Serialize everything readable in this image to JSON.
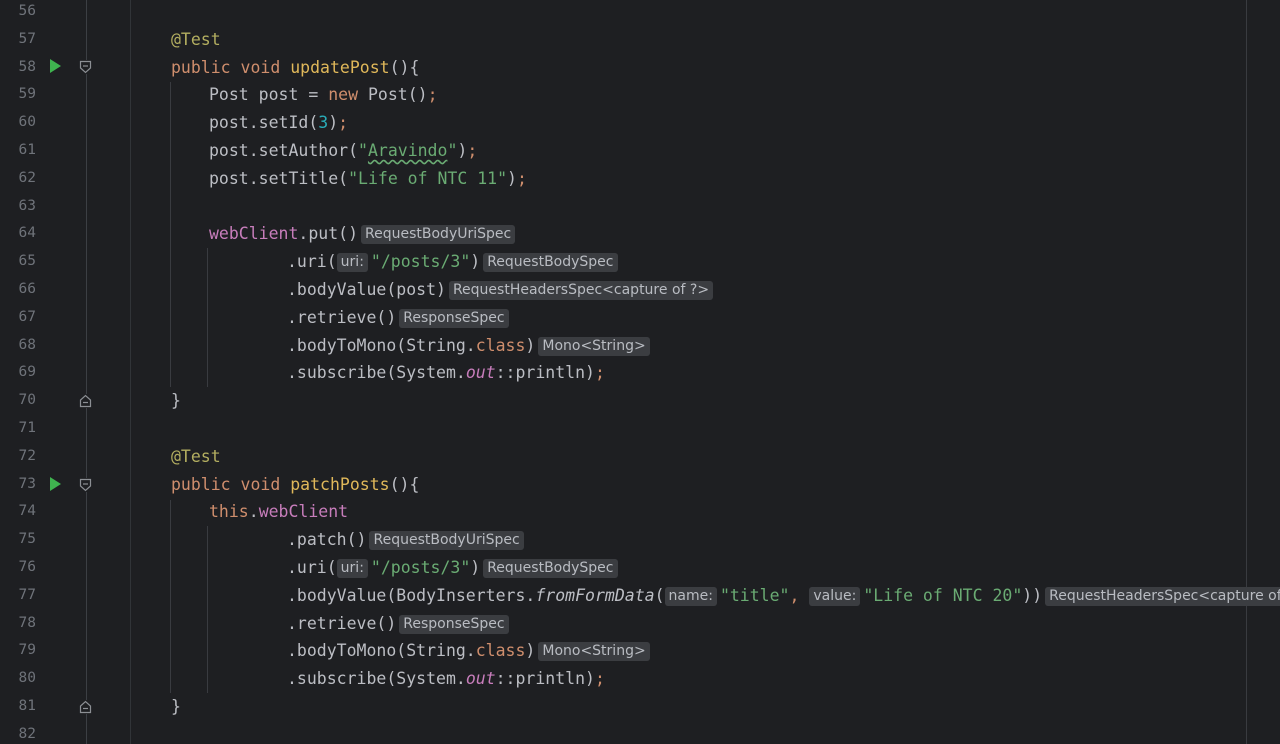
{
  "editor": {
    "background": "#1e1f22",
    "line_numbers": [
      "56",
      "57",
      "58",
      "59",
      "60",
      "61",
      "62",
      "63",
      "64",
      "65",
      "66",
      "67",
      "68",
      "69",
      "70",
      "71",
      "72",
      "73",
      "74",
      "75",
      "76",
      "77",
      "78",
      "79",
      "80",
      "81",
      "82"
    ],
    "colors": {
      "keyword": "#cf8e6d",
      "method_declaration": "#e0b85a",
      "field": "#c77dbb",
      "string": "#6aab73",
      "number": "#2aacb8",
      "annotation": "#b3ae60",
      "text": "#bcbec4",
      "run_icon": "#3fb34f"
    }
  },
  "code": {
    "l57": {
      "annotation": "@Test"
    },
    "l58": {
      "kw1": "public",
      "kw2": "void",
      "name": "updatePost",
      "rest": "(){"
    },
    "l59": {
      "a": "Post post = ",
      "kw": "new",
      "b": " Post()",
      "semi": ";"
    },
    "l60": {
      "a": "post.setId(",
      "num": "3",
      "b": ")",
      "semi": ";"
    },
    "l61": {
      "a": "post.setAuthor(",
      "str_q1": "\"",
      "str_word": "Aravindo",
      "str_q2": "\"",
      "b": ")",
      "semi": ";"
    },
    "l62": {
      "a": "post.setTitle(",
      "str": "\"Life of NTC 11\"",
      "b": ")",
      "semi": ";"
    },
    "l64": {
      "field": "webClient",
      "a": ".put()",
      "hint": "RequestBodyUriSpec"
    },
    "l65": {
      "a": ".uri(",
      "param": "uri:",
      "str": "\"/posts/3\"",
      "b": ")",
      "hint": "RequestBodySpec"
    },
    "l66": {
      "a": ".bodyValue(post)",
      "hint": "RequestHeadersSpec<capture of ?>"
    },
    "l67": {
      "a": ".retrieve()",
      "hint": "ResponseSpec"
    },
    "l68": {
      "a": ".bodyToMono(String.",
      "kw": "class",
      "b": ")",
      "hint": "Mono<String>"
    },
    "l69": {
      "a": ".subscribe(System.",
      "static": "out",
      "b": "::println)",
      "semi": ";"
    },
    "l70": {
      "a": "}"
    },
    "l72": {
      "annotation": "@Test"
    },
    "l73": {
      "kw1": "public",
      "kw2": "void",
      "name": "patchPosts",
      "rest": "(){"
    },
    "l74": {
      "kw": "this",
      "dot": ".",
      "field": "webClient"
    },
    "l75": {
      "a": ".patch()",
      "hint": "RequestBodyUriSpec"
    },
    "l76": {
      "a": ".uri(",
      "param": "uri:",
      "str": "\"/posts/3\"",
      "b": ")",
      "hint": "RequestBodySpec"
    },
    "l77": {
      "a": ".bodyValue(BodyInserters.",
      "method": "fromFormData",
      "open": "(",
      "param1": "name:",
      "str1": "\"title\"",
      "comma": ", ",
      "param2": "value:",
      "str2": "\"Life of NTC 20\"",
      "b": "))",
      "hint": "RequestHeadersSpec<capture of ?>"
    },
    "l78": {
      "a": ".retrieve()",
      "hint": "ResponseSpec"
    },
    "l79": {
      "a": ".bodyToMono(String.",
      "kw": "class",
      "b": ")",
      "hint": "Mono<String>"
    },
    "l80": {
      "a": ".subscribe(System.",
      "static": "out",
      "b": "::println)",
      "semi": ";"
    },
    "l81": {
      "a": "}"
    }
  }
}
